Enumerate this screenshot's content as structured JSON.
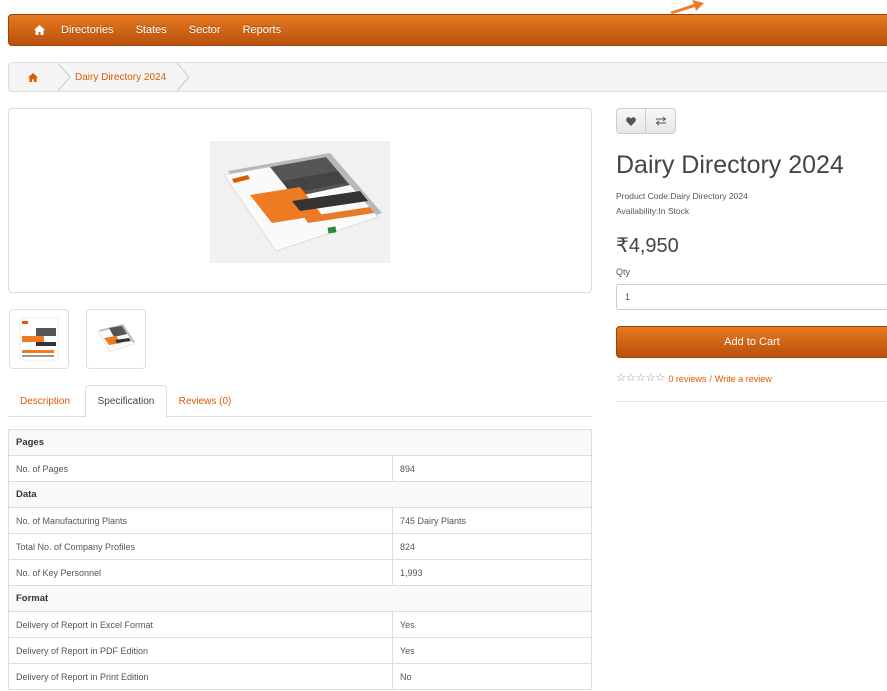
{
  "nav": {
    "items": [
      "Directories",
      "States",
      "Sector",
      "Reports"
    ]
  },
  "breadcrumb": {
    "current": "Dairy Directory 2024"
  },
  "tabs": [
    {
      "label": "Description"
    },
    {
      "label": "Specification"
    },
    {
      "label": "Reviews (0)"
    }
  ],
  "spec": {
    "sections": [
      {
        "title": "Pages",
        "rows": [
          [
            "No. of Pages",
            "894"
          ]
        ]
      },
      {
        "title": "Data",
        "rows": [
          [
            "No. of Manufacturing Plants",
            "745 Dairy Plants"
          ],
          [
            "Total No. of Company Profiles",
            "824"
          ],
          [
            "No. of Key Personnel",
            "1,993"
          ]
        ]
      },
      {
        "title": "Format",
        "rows": [
          [
            "Delivery of Report in Excel Format",
            "Yes"
          ],
          [
            "Delivery of Report in PDF Edition",
            "Yes"
          ],
          [
            "Delivery of Report in Print Edition",
            "No"
          ]
        ]
      }
    ]
  },
  "product": {
    "title": "Dairy Directory 2024",
    "code": "Product Code:Dairy Directory 2024",
    "availability": "Availability:In Stock",
    "price": "₹4,950",
    "qty_label": "Qty",
    "qty_value": "1",
    "add_to_cart": "Add to Cart",
    "reviews_link": "0 reviews",
    "review_separator": "/",
    "write_review": "Write a review"
  },
  "colors": {
    "accent": "#e05a00",
    "bar_top": "#e7791f",
    "bar_bottom": "#b9510d"
  },
  "icons": {
    "home": "home-icon",
    "wishlist": "heart-icon",
    "compare": "exchange-icon",
    "rating": "star-outline-icon"
  }
}
